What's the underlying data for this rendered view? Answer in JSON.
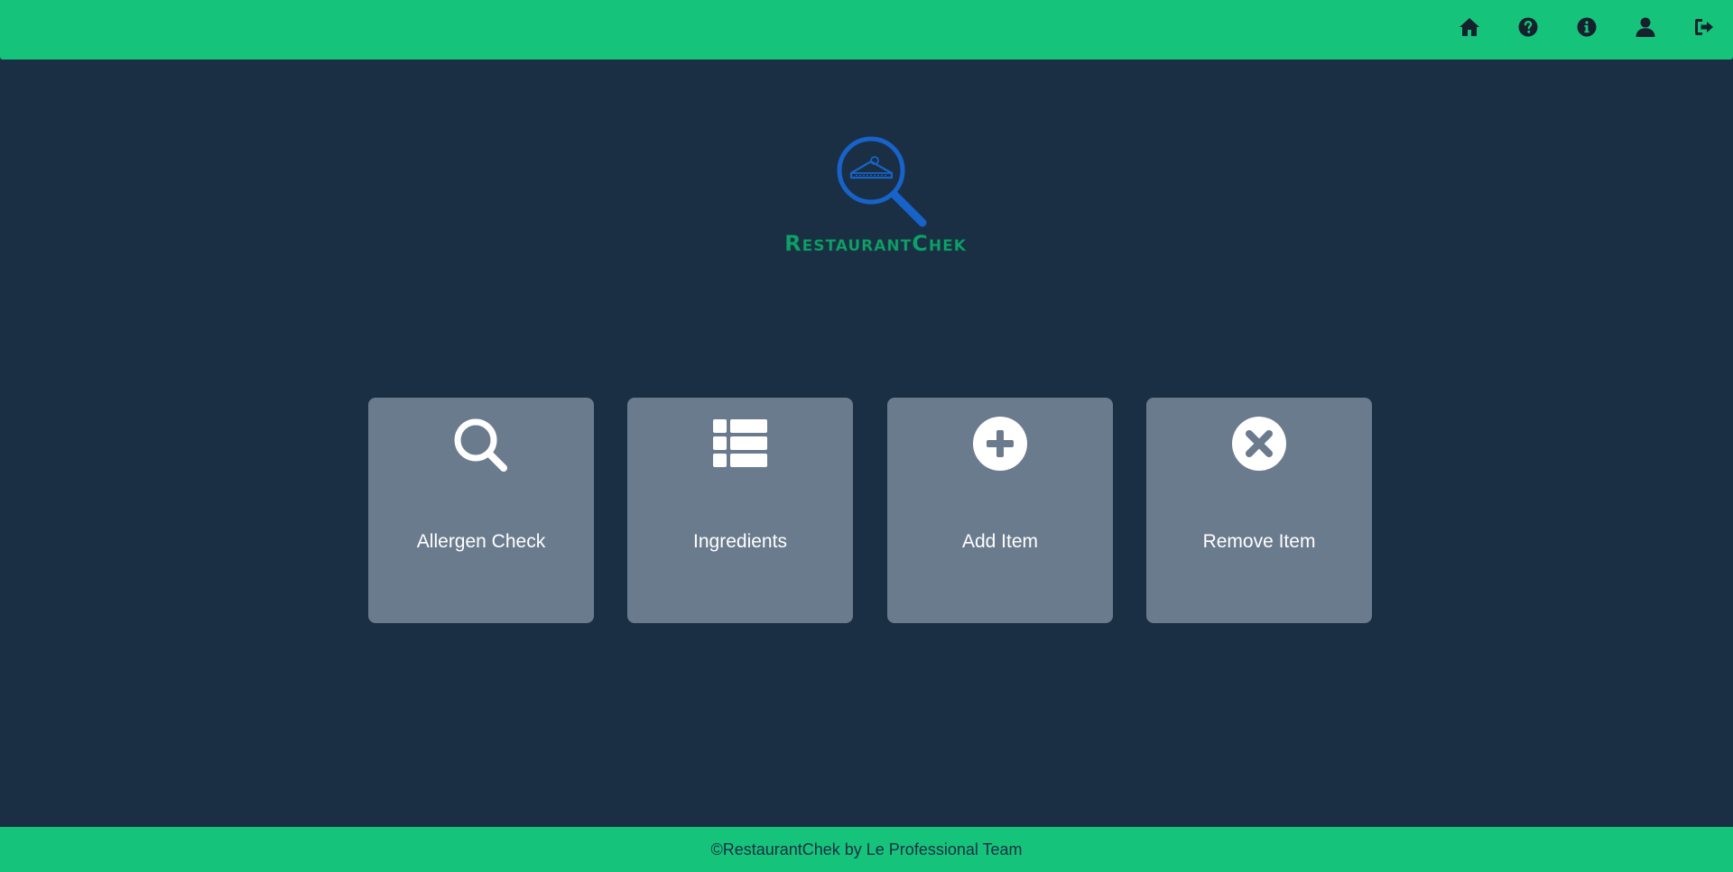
{
  "colors": {
    "background": "#1b2f44",
    "topbar": "#15c47a",
    "tile": "#6b7b8e",
    "logo_text": "#0fa06a",
    "logo_icon": "#1763c9"
  },
  "nav": {
    "icons": [
      "home-icon",
      "help-icon",
      "info-icon",
      "user-icon",
      "logout-icon"
    ]
  },
  "logo": {
    "text": "RestaurantChek"
  },
  "tiles": [
    {
      "label": "Allergen Check",
      "icon": "search-icon"
    },
    {
      "label": "Ingredients",
      "icon": "list-icon"
    },
    {
      "label": "Add Item",
      "icon": "plus-circle-icon"
    },
    {
      "label": "Remove Item",
      "icon": "x-circle-icon"
    }
  ],
  "footer": {
    "text": "©RestaurantChek by Le Professional Team"
  }
}
